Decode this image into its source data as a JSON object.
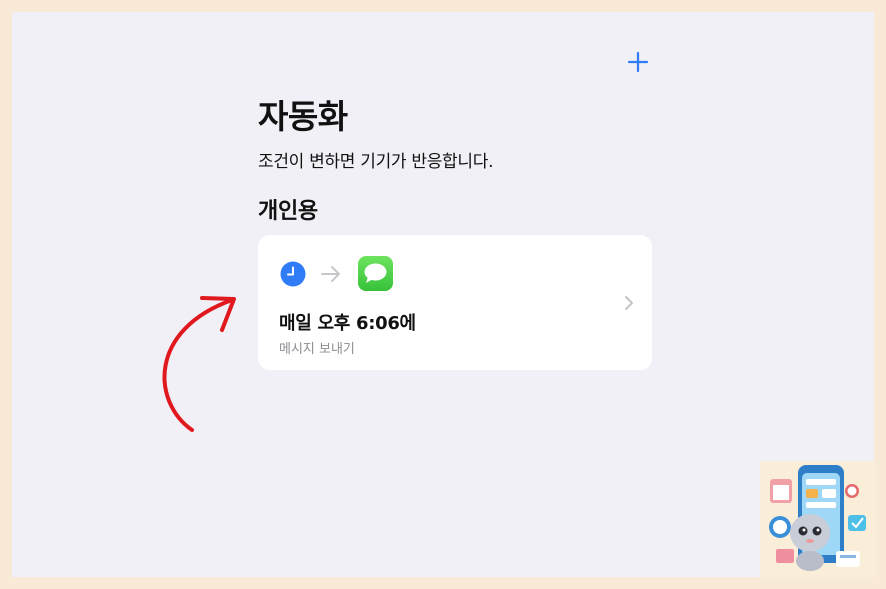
{
  "header": {
    "add_icon": "plus-icon",
    "title": "자동화",
    "subtitle": "조건이 변하면 기기가 반응합니다."
  },
  "section": {
    "title": "개인용"
  },
  "automation_card": {
    "trigger_icon": "clock-icon",
    "action_icon": "messages-icon",
    "title": "매일 오후 6:06에",
    "subtitle": "메시지 보내기"
  },
  "colors": {
    "accent": "#2f7cf6",
    "annotation_arrow": "#e0191e",
    "background": "#f1f0f6",
    "border": "#f8ead6"
  }
}
